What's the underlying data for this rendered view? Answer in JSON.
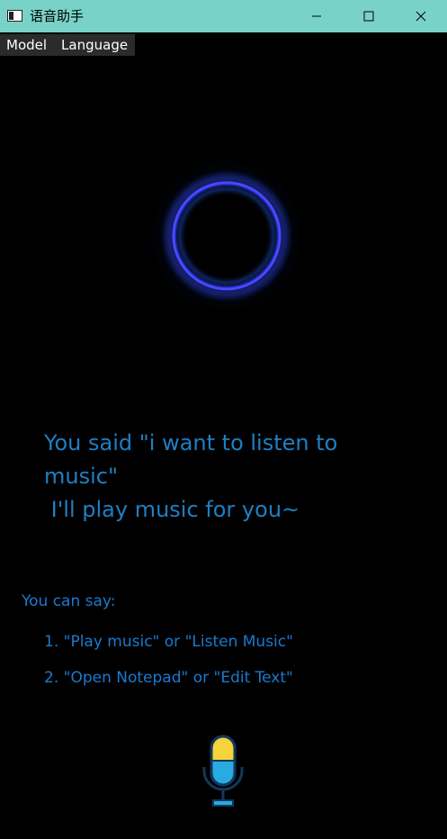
{
  "window": {
    "title": "语音助手",
    "title_bar_color": "#79d2c8"
  },
  "menu": {
    "items": [
      {
        "label": "Model"
      },
      {
        "label": "Language"
      }
    ]
  },
  "visualizer": {
    "ring_color": "#3a3aff",
    "glow_color": "#1a6bd6"
  },
  "response": {
    "lines": [
      "You said \"i want to listen to",
      "music\"",
      " I'll play music for you~"
    ]
  },
  "hints": {
    "title": "You can say:",
    "items": [
      "1. \"Play music\" or \"Listen Music\"",
      "2. \"Open Notepad\" or \"Edit Text\""
    ]
  },
  "mic": {
    "icon": "microphone-icon",
    "top_color": "#f5d33c",
    "bottom_color": "#29abe2"
  }
}
